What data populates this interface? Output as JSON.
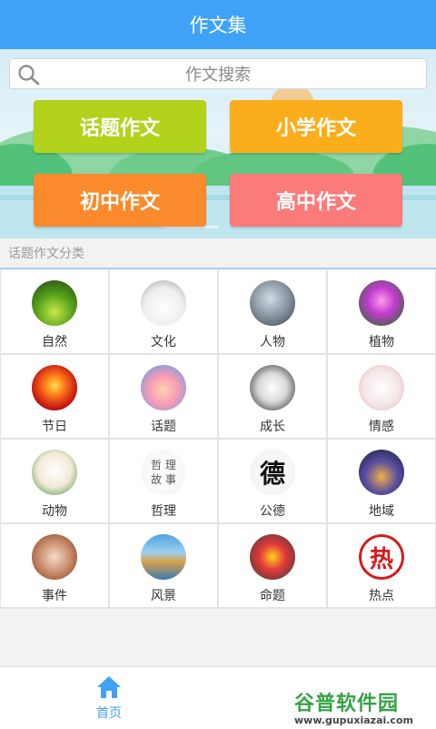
{
  "app": {
    "title": "作文集"
  },
  "search": {
    "placeholder": "作文搜索"
  },
  "categories": [
    {
      "label": "话题作文",
      "color": "#b2d21b"
    },
    {
      "label": "小学作文",
      "color": "#fbae1b"
    },
    {
      "label": "初中作文",
      "color": "#fb8a2c"
    },
    {
      "label": "高中作文",
      "color": "#fb7a7a"
    }
  ],
  "section": {
    "label": "话题作文分类"
  },
  "topics": [
    {
      "label": "自然",
      "icon": "grass-image"
    },
    {
      "label": "文化",
      "icon": "calligraphy-image"
    },
    {
      "label": "人物",
      "icon": "person-image"
    },
    {
      "label": "植物",
      "icon": "flower-image"
    },
    {
      "label": "节日",
      "icon": "fireworks-image"
    },
    {
      "label": "话题",
      "icon": "chat-couple-image"
    },
    {
      "label": "成长",
      "icon": "silhouettes-image"
    },
    {
      "label": "情感",
      "icon": "hearts-image"
    },
    {
      "label": "动物",
      "icon": "puppy-image"
    },
    {
      "label": "哲理",
      "icon": "philosophy-text-image",
      "overlay": [
        "哲 理",
        "故 事"
      ]
    },
    {
      "label": "公德",
      "icon": "virtue-calligraphy-image",
      "overlay": [
        "德"
      ]
    },
    {
      "label": "地域",
      "icon": "city-night-image"
    },
    {
      "label": "事件",
      "icon": "event-image"
    },
    {
      "label": "风景",
      "icon": "landscape-image"
    },
    {
      "label": "命题",
      "icon": "art-image"
    },
    {
      "label": "热点",
      "icon": "hot-stamp-image",
      "overlay": [
        "热"
      ]
    }
  ],
  "tabbar": {
    "home_label": "首页"
  },
  "watermark": {
    "title": "谷普软件园",
    "url": "www.gupuxiazai.com"
  }
}
